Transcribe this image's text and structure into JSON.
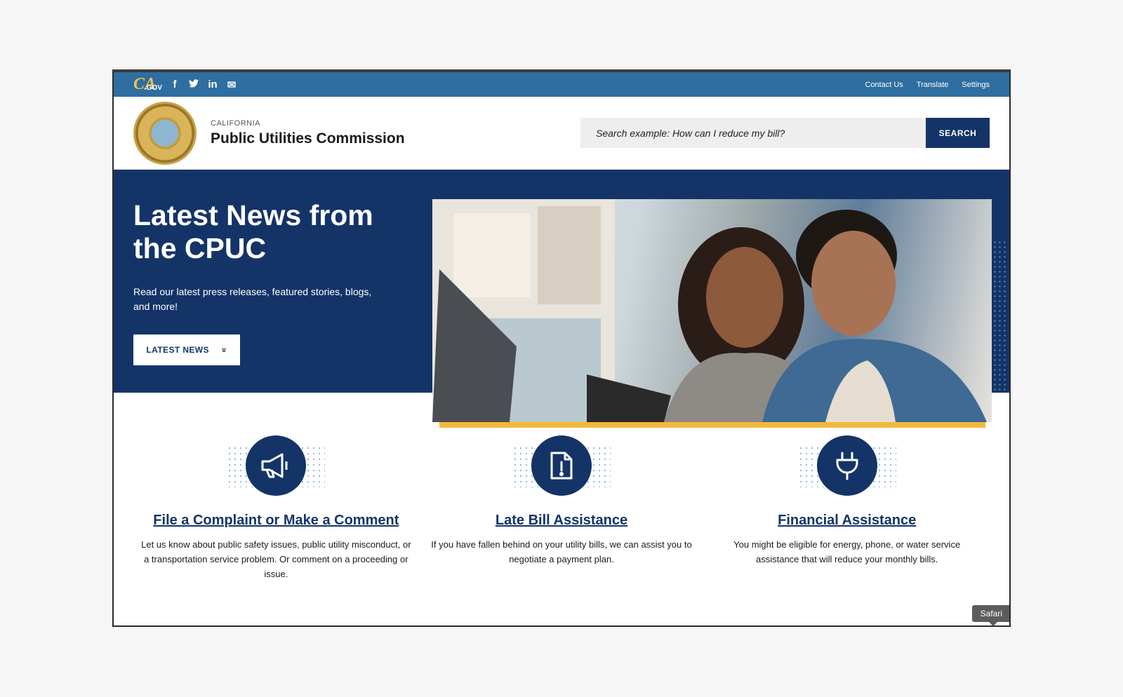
{
  "utility_bar": {
    "logo_text": "CA",
    "logo_gov": ".GOV",
    "social": [
      {
        "icon": "facebook-icon",
        "glyph": "f"
      },
      {
        "icon": "twitter-icon",
        "glyph": "t"
      },
      {
        "icon": "linkedin-icon",
        "glyph": "in"
      },
      {
        "icon": "email-icon",
        "glyph": "✉"
      }
    ],
    "links": [
      "Contact Us",
      "Translate",
      "Settings"
    ]
  },
  "header": {
    "state": "CALIFORNIA",
    "agency": "Public Utilities Commission",
    "search_placeholder": "Search example: How can I reduce my bill?",
    "search_button": "SEARCH"
  },
  "hero": {
    "title": "Latest News from the CPUC",
    "description": "Read our latest press releases, featured stories, blogs, and more!",
    "button": "LATEST NEWS",
    "button_glyph": "»"
  },
  "services": [
    {
      "icon": "megaphone-icon",
      "title": "File a Complaint or Make a Comment",
      "description": "Let us know about public safety issues, public utility misconduct, or a transportation service problem. Or comment on a proceeding or issue."
    },
    {
      "icon": "document-alert-icon",
      "title": "Late Bill Assistance",
      "description": "If you have fallen behind on your utility bills, we can assist you to negotiate a payment plan."
    },
    {
      "icon": "plug-icon",
      "title": "Financial Assistance",
      "description": "You might be eligible for energy, phone, or water service assistance that will reduce your monthly bills."
    }
  ],
  "tooltip": "Safari",
  "colors": {
    "navy": "#143468",
    "util_blue": "#2e6ea0",
    "accent_gold": "#f2b93b"
  }
}
